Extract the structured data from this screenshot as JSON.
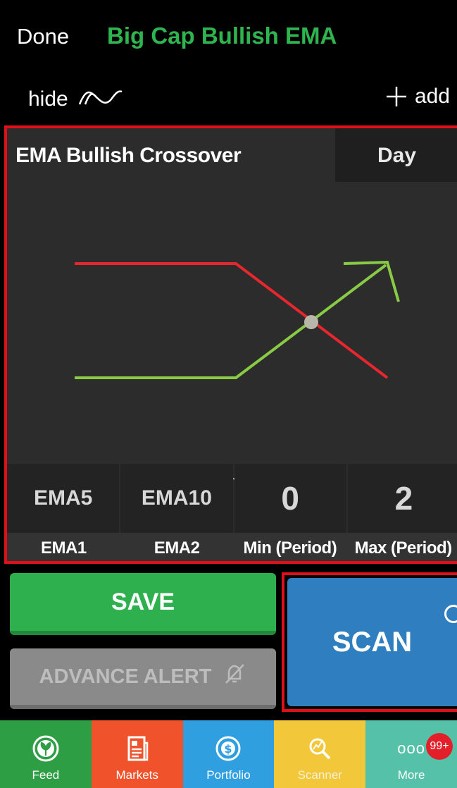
{
  "header": {
    "done_label": "Done",
    "title": "Big Cap Bullish EMA",
    "hide_label": "hide",
    "add_label": "add"
  },
  "card": {
    "title": "EMA Bullish Crossover",
    "timeframe": "Day",
    "diagram_caption": "EMA Bullish Crossover"
  },
  "params": [
    {
      "value": "EMA5",
      "label": "EMA1"
    },
    {
      "value": "EMA10",
      "label": "EMA2"
    },
    {
      "value": "0",
      "label": "Min (Period)"
    },
    {
      "value": "2",
      "label": "Max (Period)"
    }
  ],
  "buttons": {
    "save": "SAVE",
    "advance_alert": "ADVANCE ALERT",
    "scan": "SCAN"
  },
  "tabbar": {
    "items": [
      {
        "label": "Feed",
        "icon": "feed-icon",
        "color": "#2e9e44"
      },
      {
        "label": "Markets",
        "icon": "markets-icon",
        "color": "#f0532b"
      },
      {
        "label": "Portfolio",
        "icon": "portfolio-icon",
        "color": "#2f9fe0"
      },
      {
        "label": "Scanner",
        "icon": "scanner-icon",
        "color": "#f2c73a"
      },
      {
        "label": "More",
        "icon": "more-icon",
        "color": "#55c1a8"
      }
    ],
    "more_badge": "99+"
  },
  "colors": {
    "accent_green": "#2fb54f",
    "highlight_red": "#e0101a",
    "scan_blue": "#2f7ec0",
    "bearish_line": "#e8262e",
    "bullish_line": "#8acb45"
  }
}
